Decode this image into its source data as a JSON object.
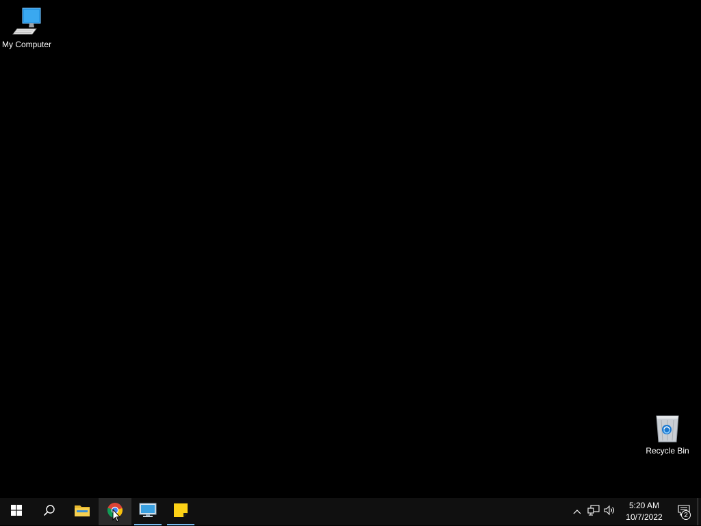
{
  "desktop": {
    "background_color": "#000000",
    "icons": [
      {
        "label": "My Computer",
        "icon": "computer-icon"
      },
      {
        "label": "Recycle Bin",
        "icon": "recycle-bin-icon"
      }
    ]
  },
  "taskbar": {
    "background_color": "#101010",
    "accent_color": "#76b9ed",
    "buttons": [
      {
        "icon": "windows-start-icon"
      },
      {
        "icon": "search-icon"
      },
      {
        "icon": "file-explorer-icon"
      },
      {
        "icon": "chrome-icon",
        "state": "hovered"
      },
      {
        "icon": "remote-desktop-icon",
        "state": "running"
      },
      {
        "icon": "sticky-notes-icon",
        "state": "running"
      }
    ],
    "tray": {
      "icons": [
        "chevron-up-icon",
        "network-icon",
        "volume-icon"
      ],
      "time": "5:20 AM",
      "date": "10/7/2022",
      "notification_count": "2"
    }
  }
}
